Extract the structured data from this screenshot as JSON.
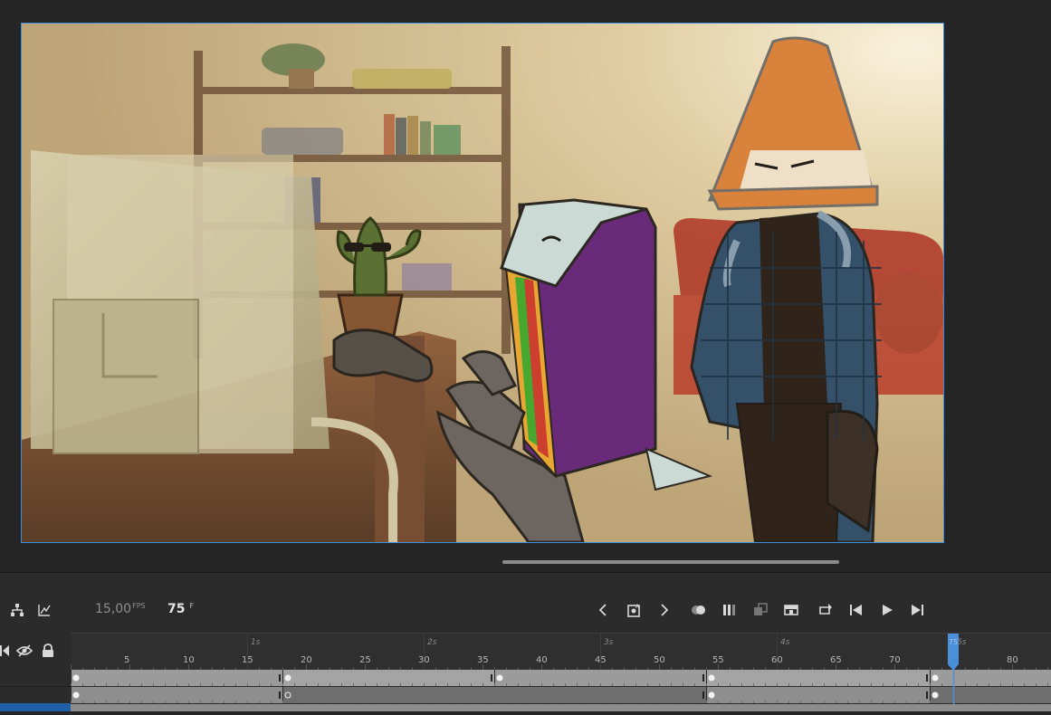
{
  "timeline": {
    "fps_value": "15,00",
    "fps_unit": "FPS",
    "current_frame": "75",
    "frame_unit": "F",
    "playhead_label": "75",
    "seconds_markers": [
      "1s",
      "2s",
      "3s",
      "4s",
      "5s"
    ],
    "frame_markers": [
      "5",
      "10",
      "15",
      "20",
      "25",
      "30",
      "35",
      "40",
      "45",
      "50",
      "55",
      "60",
      "65",
      "70",
      "75",
      "80"
    ],
    "layers": [
      {
        "keyframes": [
          1,
          19,
          37,
          55,
          74
        ]
      },
      {
        "keyframes": [
          1,
          19,
          55,
          74
        ]
      }
    ],
    "icons": {
      "left_tools": [
        "hierarchy-icon",
        "graph-icon"
      ],
      "layer_tools": [
        "audio-icon",
        "visibility-icon",
        "lock-icon"
      ],
      "playback": [
        "prev-keyframe-icon",
        "insert-keyframe-icon",
        "next-keyframe-icon",
        "onion-skin-icon",
        "onion-outline-icon",
        "edit-multiple-frames-icon",
        "frame-view-icon",
        "loop-icon",
        "step-back-icon",
        "play-icon",
        "step-forward-icon"
      ]
    },
    "colors": {
      "accent": "#3c8fd8",
      "playhead": "#4a90d9"
    }
  },
  "stage": {
    "border_color": "#3c8fd8"
  }
}
